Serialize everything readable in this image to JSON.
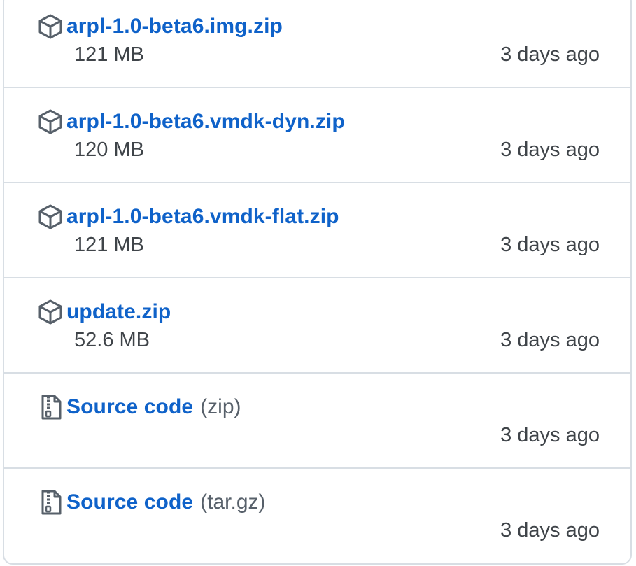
{
  "assets": [
    {
      "icon": "package-icon",
      "name": "arpl-1.0-beta6.img.zip",
      "suffix": "",
      "size": "121 MB",
      "date": "3 days ago"
    },
    {
      "icon": "package-icon",
      "name": "arpl-1.0-beta6.vmdk-dyn.zip",
      "suffix": "",
      "size": "120 MB",
      "date": "3 days ago"
    },
    {
      "icon": "package-icon",
      "name": "arpl-1.0-beta6.vmdk-flat.zip",
      "suffix": "",
      "size": "121 MB",
      "date": "3 days ago"
    },
    {
      "icon": "package-icon",
      "name": "update.zip",
      "suffix": "",
      "size": "52.6 MB",
      "date": "3 days ago"
    },
    {
      "icon": "file-zip-icon",
      "name": "Source code",
      "suffix": "(zip)",
      "size": "",
      "date": "3 days ago"
    },
    {
      "icon": "file-zip-icon",
      "name": "Source code",
      "suffix": "(tar.gz)",
      "size": "",
      "date": "3 days ago"
    }
  ],
  "colors": {
    "link": "#0f62c9",
    "text": "#3f4449",
    "border": "#d8dee4",
    "icon": "#57606a"
  }
}
